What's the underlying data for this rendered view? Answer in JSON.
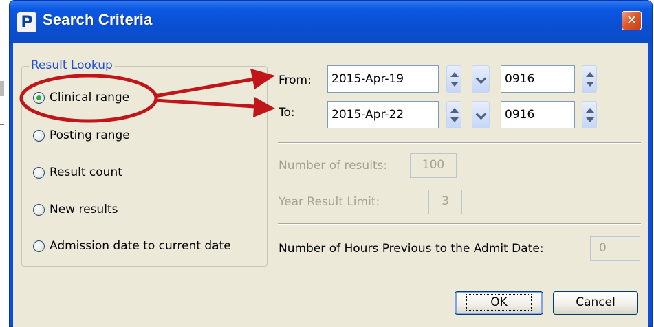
{
  "window": {
    "title": "Search Criteria",
    "app_logo_letter": "P",
    "close_glyph": "✕"
  },
  "group": {
    "legend": "Result Lookup",
    "options": [
      {
        "label": "Clinical range",
        "selected": true
      },
      {
        "label": "Posting range",
        "selected": false
      },
      {
        "label": "Result count",
        "selected": false
      },
      {
        "label": "New results",
        "selected": false
      },
      {
        "label": "Admission date to current date",
        "selected": false
      }
    ]
  },
  "from": {
    "label": "From:",
    "date": "2015-Apr-19",
    "time": "0916"
  },
  "to": {
    "label": "To:",
    "date": "2015-Apr-22",
    "time": "0916"
  },
  "number_of_results": {
    "label": "Number of results:",
    "value": "100"
  },
  "year_result_limit": {
    "label": "Year Result Limit:",
    "value": "3"
  },
  "hours_previous": {
    "label": "Number of Hours Previous to the Admit Date:",
    "value": "0"
  },
  "buttons": {
    "ok": "OK",
    "cancel": "Cancel"
  },
  "colors": {
    "annotation": "#c0161a",
    "legend": "#1f4fd8",
    "titlebar": "#0b58e2"
  },
  "icons": {
    "spin": "spin-updown-icon",
    "dropdown": "chevron-down-icon",
    "close": "close-icon"
  }
}
